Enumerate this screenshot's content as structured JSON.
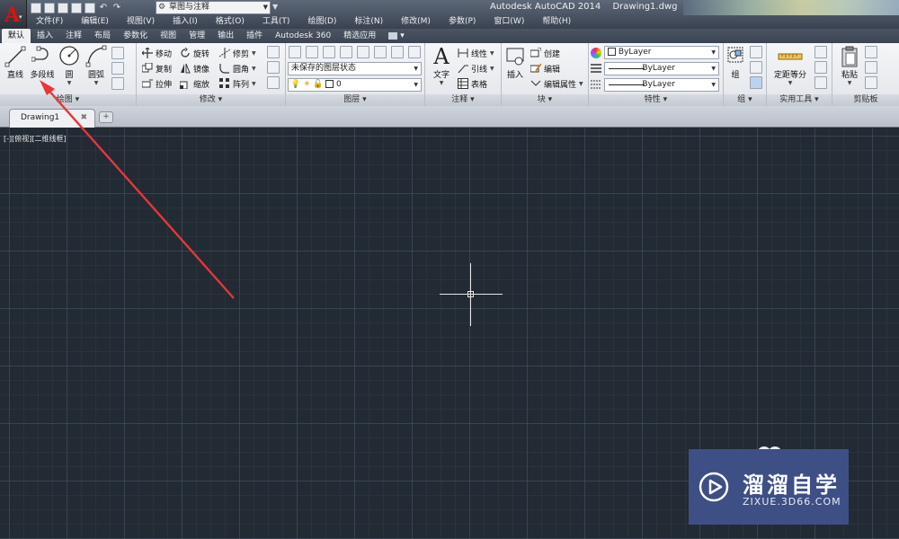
{
  "titlebar": {
    "workspace": "草图与注释",
    "app_name": "Autodesk AutoCAD 2014",
    "file_name": "Drawing1.dwg"
  },
  "menus": [
    "文件(F)",
    "编辑(E)",
    "视图(V)",
    "插入(I)",
    "格式(O)",
    "工具(T)",
    "绘图(D)",
    "标注(N)",
    "修改(M)",
    "参数(P)",
    "窗口(W)",
    "帮助(H)"
  ],
  "ribbon_tabs": [
    "默认",
    "插入",
    "注释",
    "布局",
    "参数化",
    "视图",
    "管理",
    "输出",
    "插件",
    "Autodesk 360",
    "精选应用"
  ],
  "draw": {
    "title": "绘图",
    "line": "直线",
    "polyline": "多段线",
    "circle": "圆",
    "arc": "圆弧"
  },
  "modify": {
    "title": "修改",
    "move": "移动",
    "rotate": "旋转",
    "trim": "修剪",
    "copy": "复制",
    "mirror": "镜像",
    "fillet": "圆角",
    "stretch": "拉伸",
    "scale": "缩放",
    "array": "阵列"
  },
  "layers": {
    "title": "图层",
    "state": "未保存的图层状态",
    "current": "0"
  },
  "annotation": {
    "title": "注释",
    "text": "文字",
    "linear": "线性",
    "leader": "引线",
    "table": "表格"
  },
  "block": {
    "title": "块",
    "insert": "插入",
    "create": "创建",
    "edit": "编辑",
    "edit_attr": "编辑属性"
  },
  "properties": {
    "title": "特性",
    "color": "ByLayer",
    "lineweight": "ByLayer",
    "linetype": "ByLayer"
  },
  "groups": {
    "title": "组",
    "group": "组"
  },
  "utilities": {
    "title": "实用工具",
    "measure": "定距等分"
  },
  "clipboard": {
    "title": "剪贴板",
    "paste": "粘贴"
  },
  "document": {
    "tab": "Drawing1"
  },
  "canvas": {
    "viewport_label": "[-][俯视][二维线框]"
  },
  "watermark": {
    "name": "溜溜自学",
    "url": "ZIXUE.3D66.COM"
  },
  "colors": {
    "canvas": "#222a33",
    "annotation_arrow": "#e8353a",
    "watermark_bg": "#3e4f86"
  }
}
